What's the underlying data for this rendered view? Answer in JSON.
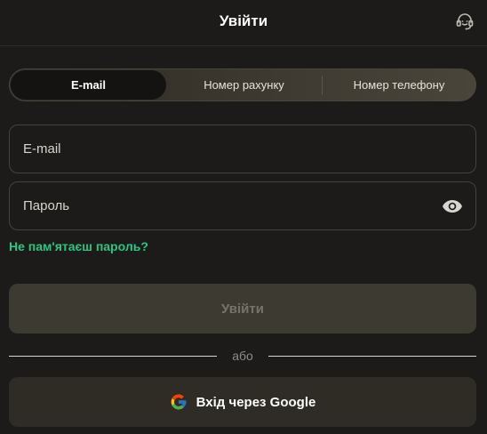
{
  "header": {
    "title": "Увійти",
    "support_icon": "headset-icon"
  },
  "tabs": [
    {
      "label": "E-mail",
      "active": true
    },
    {
      "label": "Номер рахунку",
      "active": false
    },
    {
      "label": "Номер телефону",
      "active": false
    }
  ],
  "form": {
    "email_placeholder": "E-mail",
    "email_value": "",
    "password_placeholder": "Пароль",
    "password_value": "",
    "show_password_icon": "eye-icon",
    "forgot_link": "Не пам'ятаєш пароль?",
    "submit_label": "Увійти",
    "submit_disabled": true
  },
  "divider": {
    "text": "або"
  },
  "google": {
    "label": "Вхід через Google",
    "icon": "google-icon"
  },
  "colors": {
    "accent_link": "#27c784",
    "background": "#1c1b19",
    "disabled_button": "#3d3a32",
    "google_button": "#2f2c25"
  }
}
